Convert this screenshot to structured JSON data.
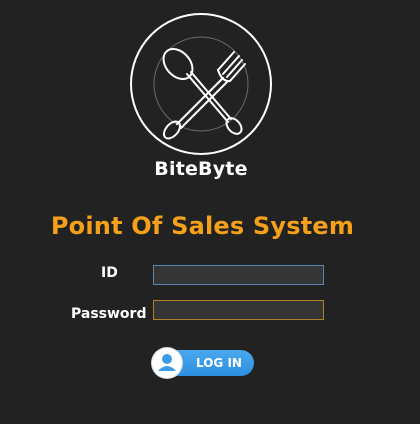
{
  "app": {
    "logo_text": "BiteByte",
    "title": "Point Of Sales System"
  },
  "form": {
    "id_label": "ID",
    "id_value": "",
    "password_label": "Password",
    "password_value": "",
    "login_label": "LOG IN",
    "login_icon": "user-icon"
  },
  "colors": {
    "background": "#222222",
    "title": "#f5a019",
    "button": "#3a9be8",
    "id_border": "#5b84b1",
    "password_border": "#b08226"
  }
}
